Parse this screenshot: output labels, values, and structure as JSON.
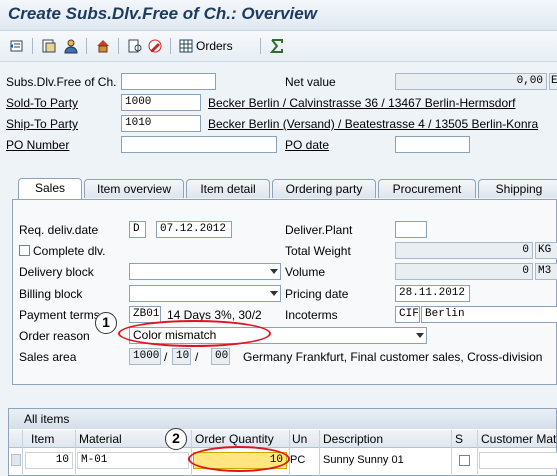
{
  "window": {
    "title": "Create Subs.Dlv.Free of Ch.: Overview"
  },
  "toolbar": {
    "orders_label": "Orders"
  },
  "header": {
    "subs_label": "Subs.Dlv.Free of Ch.",
    "subs_value": "",
    "net_value_label": "Net value",
    "net_value": "0,00",
    "currency_partial": "E",
    "sold_to_label": "Sold-To Party",
    "sold_to_value": "1000",
    "sold_to_text": "Becker Berlin / Calvinstrasse 36 / 13467 Berlin-Hermsdorf",
    "ship_to_label": "Ship-To Party",
    "ship_to_value": "1010",
    "ship_to_text": "Becker Berlin (Versand) / Beatestrasse 4 / 13505 Berlin-Konra",
    "po_number_label": "PO Number",
    "po_number_value": "",
    "po_date_label": "PO date",
    "po_date_value": ""
  },
  "tabs": [
    "Sales",
    "Item overview",
    "Item detail",
    "Ordering party",
    "Procurement",
    "Shipping"
  ],
  "sales": {
    "req_deliv_label": "Req. deliv.date",
    "req_deliv_type": "D",
    "req_deliv_date": "07.12.2012",
    "deliver_plant_label": "Deliver.Plant",
    "deliver_plant_value": "",
    "complete_dlv_label": "Complete dlv.",
    "total_weight_label": "Total Weight",
    "total_weight_value": "0",
    "total_weight_unit": "KG",
    "delivery_block_label": "Delivery block",
    "delivery_block_value": "",
    "volume_label": "Volume",
    "volume_value": "0",
    "volume_unit": "M3",
    "billing_block_label": "Billing block",
    "billing_block_value": "",
    "pricing_date_label": "Pricing date",
    "pricing_date_value": "28.11.2012",
    "payment_terms_label": "Payment terms",
    "payment_terms_code": "ZB01",
    "payment_terms_text": "14 Days 3%, 30/2",
    "incoterms_label": "Incoterms",
    "incoterms_code": "CIF",
    "incoterms_place": "Berlin",
    "order_reason_label": "Order reason",
    "order_reason_value": "Color mismatch",
    "sales_area_label": "Sales area",
    "sales_org": "1000",
    "dist_channel": "10",
    "division": "00",
    "sep": "/",
    "sales_area_text": "Germany Frankfurt, Final customer sales, Cross-division"
  },
  "annotations": {
    "badge1": "1",
    "badge2": "2"
  },
  "items": {
    "title": "All items",
    "columns": [
      "Item",
      "Material",
      "Order Quantity",
      "Un",
      "Description",
      "S",
      "Customer Mat"
    ],
    "rows": [
      {
        "item": "10",
        "material": "M-01",
        "quantity": "10",
        "unit": "PC",
        "description": "Sunny Sunny 01"
      }
    ]
  },
  "colors": {
    "highlight": "#e0141e",
    "quantity_fill": "#ffe680"
  }
}
